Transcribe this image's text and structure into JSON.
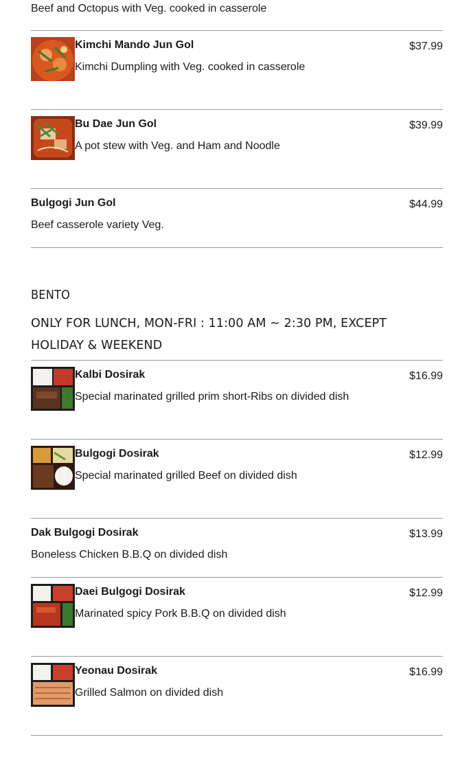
{
  "top_fragment": {
    "description": "Beef and Octopus with Veg. cooked in casserole"
  },
  "hotpot_items": [
    {
      "name": "Kimchi Mando Jun Gol",
      "description": "Kimchi Dumpling with Veg. cooked in casserole",
      "price": "$37.99",
      "image_icon": "kimchi-stew-photo"
    },
    {
      "name": "Bu Dae Jun Gol",
      "description": "A pot stew with Veg. and Ham and Noodle",
      "price": "$39.99",
      "image_icon": "army-stew-photo"
    },
    {
      "name": "Bulgogi Jun Gol",
      "description": "Beef casserole variety Veg.",
      "price": "$44.99"
    }
  ],
  "bento_section": {
    "title": "BENTO",
    "note": "ONLY FOR LUNCH, MON-FRI : 11:00 AM ~ 2:30 PM, EXCEPT HOLIDAY & WEEKEND"
  },
  "bento_items": [
    {
      "name": "Kalbi Dosirak",
      "description": "Special marinated grilled prim short-Ribs on divided dish",
      "price": "$16.99",
      "image_icon": "kalbi-bento-photo"
    },
    {
      "name": "Bulgogi Dosirak",
      "description": "Special marinated grilled Beef on divided dish",
      "price": "$12.99",
      "image_icon": "bulgogi-bento-photo"
    },
    {
      "name": "Dak Bulgogi Dosirak",
      "description": "Boneless Chicken B.B.Q on divided dish",
      "price": "$13.99"
    },
    {
      "name": "Daei Bulgogi Dosirak",
      "description": "Marinated spicy Pork B.B.Q on divided dish",
      "price": "$12.99",
      "image_icon": "spicy-pork-bento-photo"
    },
    {
      "name": "Yeonau Dosirak",
      "description": "Grilled Salmon on divided dish",
      "price": "$16.99",
      "image_icon": "salmon-bento-photo"
    }
  ],
  "colors": {
    "divider": "#9a9a9a",
    "text": "#1a1a1a",
    "background": "#ffffff"
  }
}
